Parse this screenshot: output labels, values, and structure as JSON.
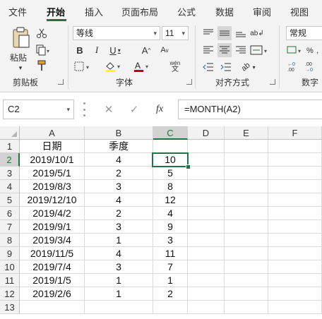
{
  "ribbon": {
    "tabs": [
      "文件",
      "开始",
      "插入",
      "页面布局",
      "公式",
      "数据",
      "审阅",
      "视图"
    ],
    "active_tab": "开始",
    "clipboard": {
      "paste_label": "粘贴",
      "group_label": "剪贴板"
    },
    "font": {
      "font_name": "等线",
      "font_size": "11",
      "phonetic_label": "wén",
      "phonetic_char": "文",
      "group_label": "字体"
    },
    "alignment": {
      "group_label": "对齐方式"
    },
    "number": {
      "format": "常规",
      "group_label": "数字"
    }
  },
  "formula_bar": {
    "name_box": "C2",
    "fx_label": "fx",
    "formula": "=MONTH(A2)"
  },
  "grid": {
    "columns": [
      "A",
      "B",
      "C",
      "D",
      "E",
      "F"
    ],
    "selected_column": "C",
    "selected_row": "2",
    "rows": [
      {
        "n": "1",
        "a": "日期",
        "b": "季度",
        "c": ""
      },
      {
        "n": "2",
        "a": "2019/10/1",
        "b": "4",
        "c": "10"
      },
      {
        "n": "3",
        "a": "2019/5/1",
        "b": "2",
        "c": "5"
      },
      {
        "n": "4",
        "a": "2019/8/3",
        "b": "3",
        "c": "8"
      },
      {
        "n": "5",
        "a": "2019/12/10",
        "b": "4",
        "c": "12"
      },
      {
        "n": "6",
        "a": "2019/4/2",
        "b": "2",
        "c": "4"
      },
      {
        "n": "7",
        "a": "2019/9/1",
        "b": "3",
        "c": "9"
      },
      {
        "n": "8",
        "a": "2019/3/4",
        "b": "1",
        "c": "3"
      },
      {
        "n": "9",
        "a": "2019/11/5",
        "b": "4",
        "c": "11"
      },
      {
        "n": "10",
        "a": "2019/7/4",
        "b": "3",
        "c": "7"
      },
      {
        "n": "11",
        "a": "2019/1/5",
        "b": "1",
        "c": "1"
      },
      {
        "n": "12",
        "a": "2019/2/6",
        "b": "1",
        "c": "2"
      },
      {
        "n": "13",
        "a": "",
        "b": "",
        "c": ""
      }
    ]
  },
  "colors": {
    "accent": "#217346",
    "ribbon_bg": "#f3f3f3",
    "header_bg": "#f2f2f2"
  }
}
